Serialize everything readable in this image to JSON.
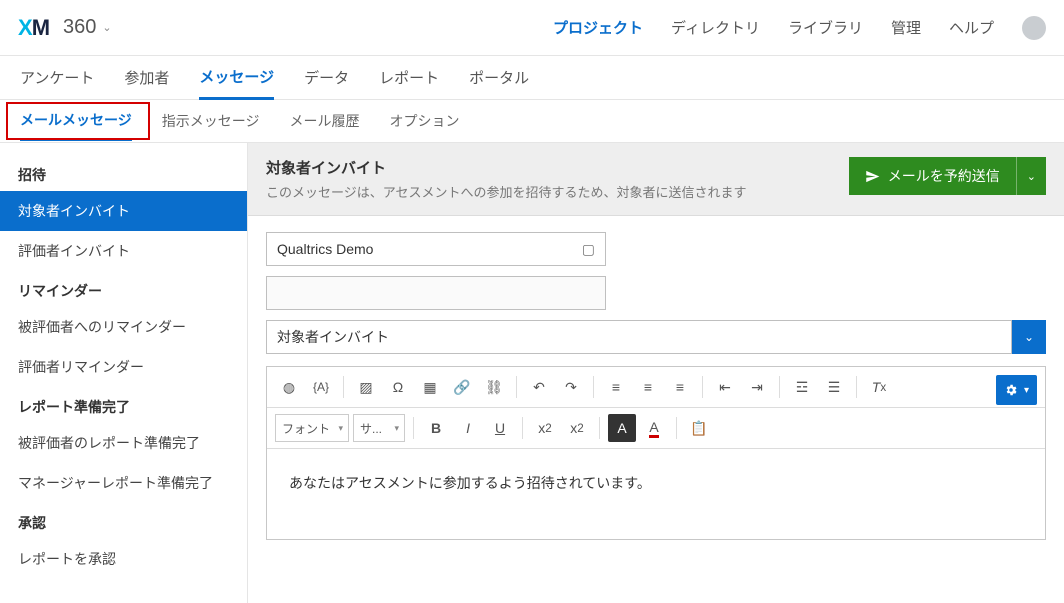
{
  "brand": {
    "x": "X",
    "m": "M",
    "app_name": "360"
  },
  "topnav": {
    "projects": "プロジェクト",
    "directory": "ディレクトリ",
    "library": "ライブラリ",
    "admin": "管理",
    "help": "ヘルプ"
  },
  "maintabs": {
    "survey": "アンケート",
    "participants": "参加者",
    "messages": "メッセージ",
    "data": "データ",
    "reports": "レポート",
    "portal": "ポータル"
  },
  "subtabs": {
    "email_messages": "メールメッセージ",
    "instruction_messages": "指示メッセージ",
    "email_history": "メール履歴",
    "options": "オプション"
  },
  "sidebar": {
    "invite_heading": "招待",
    "subject_invite": "対象者インバイト",
    "evaluator_invite": "評価者インバイト",
    "reminder_heading": "リマインダー",
    "subject_reminder": "被評価者へのリマインダー",
    "evaluator_reminder": "評価者リマインダー",
    "report_heading": "レポート準備完了",
    "subject_report_ready": "被評価者のレポート準備完了",
    "manager_report_ready": "マネージャーレポート準備完了",
    "approval_heading": "承認",
    "approve_report": "レポートを承認"
  },
  "panel": {
    "title": "対象者インバイト",
    "subtitle": "このメッセージは、アセスメントへの参加を招待するため、対象者に送信されます",
    "send_button": "メールを予約送信"
  },
  "fields": {
    "from_name": "Qualtrics Demo",
    "from_email": "",
    "subject": "対象者インバイト"
  },
  "toolbar2": {
    "font_label": "フォント",
    "size_label": "サ..."
  },
  "editor": {
    "body_text": "あなたはアセスメントに参加するよう招待されています。"
  }
}
